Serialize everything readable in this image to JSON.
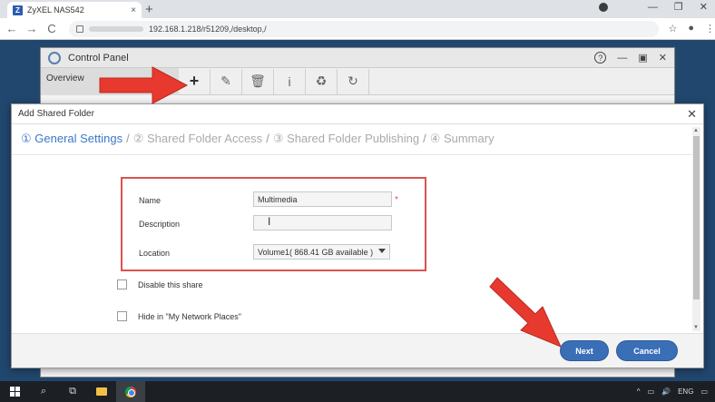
{
  "browser": {
    "tab_title": "ZyXEL NAS542",
    "tab_favicon": "Z",
    "tab_close": "×",
    "new_tab": "+",
    "address": "192.168.1.218/r51209,/desktop,/",
    "back": "←",
    "forward": "→",
    "reload": "C",
    "bookmark": "☆",
    "menu": "⋮",
    "minimize": "—",
    "maximize": "❐",
    "close": "✕"
  },
  "control_panel": {
    "title": "Control Panel",
    "help": "?",
    "minimize": "—",
    "maximize": "▣",
    "close": "✕",
    "sidebar_first": "Overview",
    "toolbar": {
      "add": "+",
      "edit": "✎",
      "delete": "🗑",
      "info": "i",
      "recycle": "♻",
      "refresh": "↻"
    }
  },
  "dialog": {
    "title": "Add Shared Folder",
    "close": "✕",
    "steps": [
      {
        "label": "① General Settings",
        "active": true
      },
      {
        "label": "② Shared Folder Access",
        "active": false
      },
      {
        "label": "③ Shared Folder Publishing",
        "active": false
      },
      {
        "label": "④ Summary",
        "active": false
      }
    ],
    "step_separator": "/",
    "fields": {
      "name_label": "Name",
      "name_value": "Multimedia",
      "required_mark": "*",
      "description_label": "Description",
      "description_value": "",
      "location_label": "Location",
      "location_value": "Volume1( 868.41 GB available )"
    },
    "checkboxes": {
      "disable_share": "Disable this share",
      "hide_network_places": "Hide in \"My Network Places\""
    },
    "buttons": {
      "next": "Next",
      "cancel": "Cancel"
    }
  },
  "taskbar": {
    "search": "⌕",
    "task_view": "⧉",
    "tray_lang": "ENG",
    "tray_up": "^",
    "tray_network": "▭",
    "tray_volume": "🔊",
    "tray_notify": "▭"
  },
  "colors": {
    "accent": "#3a6fb8",
    "highlight_box": "#d9534f",
    "arrow": "#e8392e",
    "step_active": "#3a78c8"
  }
}
